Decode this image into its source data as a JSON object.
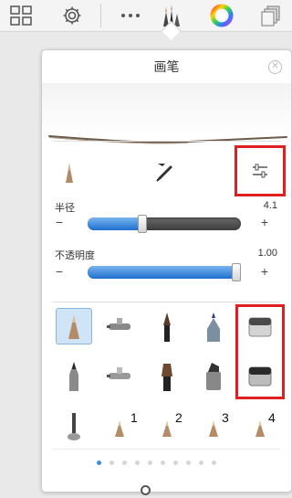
{
  "toolbar": {
    "items": [
      "layout-grid-icon",
      "settings-gear-icon",
      "more-icon",
      "brush-tool-icon",
      "color-wheel-icon",
      "layers-icon"
    ]
  },
  "panel": {
    "title": "画笔",
    "close_icon": "close-icon",
    "sliders": [
      {
        "label": "半径",
        "value": "4.1",
        "fraction": 0.355
      },
      {
        "label": "不透明度",
        "value": "1.00",
        "fraction": 1.0
      }
    ],
    "minus": "−",
    "plus": "+",
    "brush_numbers": [
      "1",
      "2",
      "3",
      "4"
    ],
    "page_count": 10,
    "active_page": 0
  },
  "colors": {
    "accent": "#1e6fcf",
    "highlight_box": "#e02020"
  }
}
